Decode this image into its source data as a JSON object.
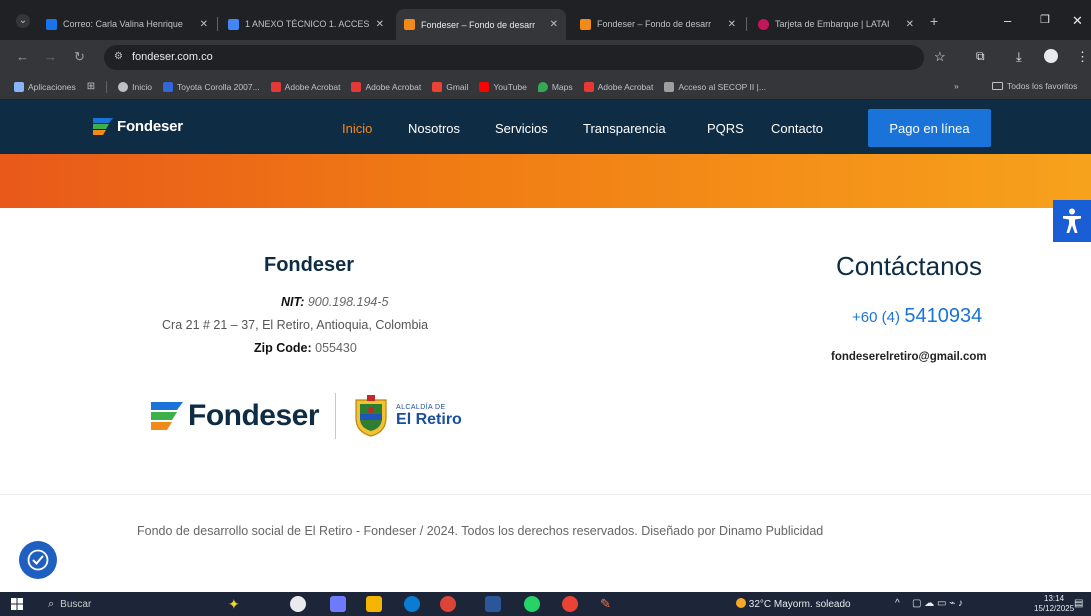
{
  "browser": {
    "tabs": [
      {
        "title": "Correo: Carla Valina Henrique",
        "active": false,
        "favicon_color": "#1a73e8"
      },
      {
        "title": "1 ANEXO TÉCNICO 1. ACCES",
        "active": false,
        "favicon_color": "#4285f4"
      },
      {
        "title": "Fondeser – Fondo de desarr",
        "active": true,
        "favicon_color": "#f28a1a"
      },
      {
        "title": "Fondeser – Fondo de desarr",
        "active": false,
        "favicon_color": "#f28a1a"
      },
      {
        "title": "Tarjeta de Embarque | LATAI",
        "active": false,
        "favicon_color": "#c2185b"
      }
    ],
    "url": "fondeser.com.co",
    "bookmarks": [
      {
        "label": "Aplicaciones",
        "icon": "apps-grid-icon",
        "color": "#8ab4f8"
      },
      {
        "label": "Inicio",
        "icon": "globe-icon",
        "color": "#bdc1c6"
      },
      {
        "label": "Toyota Corolla 2007...",
        "icon": "tucarro-icon",
        "color": "#3367d6"
      },
      {
        "label": "Adobe Acrobat",
        "icon": "acrobat-icon",
        "color": "#e53935"
      },
      {
        "label": "Adobe Acrobat",
        "icon": "acrobat-icon",
        "color": "#e53935"
      },
      {
        "label": "Gmail",
        "icon": "gmail-icon",
        "color": "#ea4335"
      },
      {
        "label": "YouTube",
        "icon": "youtube-icon",
        "color": "#ff0000"
      },
      {
        "label": "Maps",
        "icon": "maps-icon",
        "color": "#34a853"
      },
      {
        "label": "Adobe Acrobat",
        "icon": "acrobat-icon",
        "color": "#e53935"
      },
      {
        "label": "Acceso al SECOP II |...",
        "icon": "secop-icon",
        "color": "#9e9e9e"
      }
    ],
    "bookmarks_overflow": "»",
    "all_bookmarks": "Todos los favoritos"
  },
  "site": {
    "brand": "Fondeser",
    "nav": [
      {
        "label": "Inicio",
        "active": true
      },
      {
        "label": "Nosotros",
        "active": false
      },
      {
        "label": "Servicios",
        "active": false
      },
      {
        "label": "Transparencia",
        "active": false
      },
      {
        "label": "PQRS",
        "active": false
      },
      {
        "label": "Contacto",
        "active": false
      }
    ],
    "pay_button": "Pago en línea",
    "colors": {
      "navy": "#0f2c45",
      "orange": "#f28a1a",
      "blue": "#1a73d9"
    }
  },
  "footer": {
    "title": "Fondeser",
    "nit_label": "NIT:",
    "nit_value": "900.198.194-5",
    "address": "Cra 21 # 21 – 37, El Retiro, Antioquia, Colombia",
    "zip_label": "Zip Code:",
    "zip_value": "055430",
    "contact_title": "Contáctanos",
    "phone_prefix": "+60 (4)",
    "phone_number": "5410934",
    "email": "fondeserelretiro@gmail.com",
    "logo_text": "Fondeser",
    "alcaldia_small": "ALCALDÍA DE",
    "alcaldia_big": "El Retiro",
    "copyright": "Fondo de desarrollo social de El Retiro - Fondeser / 2024. Todos los derechos reservados. Diseñado por Dinamo Publicidad"
  },
  "taskbar": {
    "search_placeholder": "Buscar",
    "weather": "32°C  Mayorm. soleado",
    "time": "13:14",
    "date": "15/12/2025"
  }
}
